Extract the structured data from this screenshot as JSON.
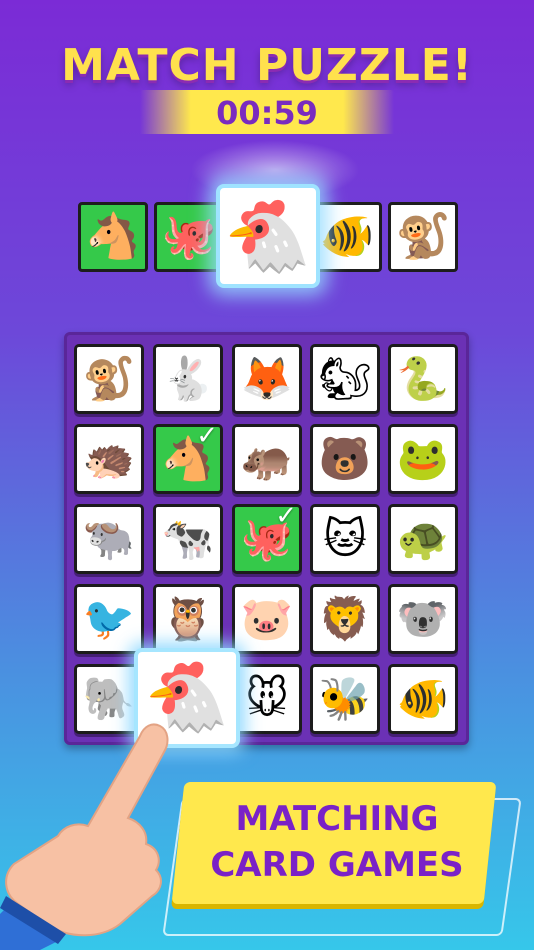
{
  "header": {
    "title": "MATCH PUZZLE!",
    "timer": "00:59"
  },
  "tray": {
    "cards": [
      {
        "animal": "horse",
        "glyph": "🐴",
        "matched": true
      },
      {
        "animal": "octopus",
        "glyph": "🐙",
        "matched": true
      },
      {
        "animal": "fish",
        "glyph": "🐠",
        "matched": false
      },
      {
        "animal": "monkey",
        "glyph": "🐒",
        "matched": false
      }
    ],
    "selected": {
      "animal": "chicken",
      "glyph": "🐔"
    }
  },
  "board": {
    "rows": [
      [
        {
          "animal": "monkey",
          "glyph": "🐒"
        },
        {
          "animal": "rabbit",
          "glyph": "🐇"
        },
        {
          "animal": "fox",
          "glyph": "🦊"
        },
        {
          "animal": "squirrel",
          "glyph": "🐿"
        },
        {
          "animal": "snake",
          "glyph": "🐍"
        }
      ],
      [
        {
          "animal": "hedgehog",
          "glyph": "🦔"
        },
        {
          "animal": "horse",
          "glyph": "🐴",
          "matched": true,
          "check": "✓"
        },
        {
          "animal": "hippo",
          "glyph": "🦛"
        },
        {
          "animal": "bear",
          "glyph": "🐻"
        },
        {
          "animal": "frog",
          "glyph": "🐸"
        }
      ],
      [
        {
          "animal": "yak",
          "glyph": "🐃"
        },
        {
          "animal": "cow",
          "glyph": "🐄"
        },
        {
          "animal": "octopus",
          "glyph": "🐙",
          "matched": true,
          "check": "✓"
        },
        {
          "animal": "cat",
          "glyph": "🐱"
        },
        {
          "animal": "turtle",
          "glyph": "🐢"
        }
      ],
      [
        {
          "animal": "sparrow",
          "glyph": "🐦"
        },
        {
          "animal": "owl",
          "glyph": "🦉"
        },
        {
          "animal": "pig",
          "glyph": "🐷"
        },
        {
          "animal": "lion",
          "glyph": "🦁"
        },
        {
          "animal": "koala",
          "glyph": "🐨"
        }
      ],
      [
        {
          "animal": "elephant",
          "glyph": "🐘"
        },
        {
          "animal": "chicken",
          "glyph": "🐔"
        },
        {
          "animal": "mouse",
          "glyph": "🐭"
        },
        {
          "animal": "wasp",
          "glyph": "🐝"
        },
        {
          "animal": "fish",
          "glyph": "🐠"
        }
      ]
    ],
    "dragging": {
      "animal": "chicken",
      "glyph": "🐔"
    }
  },
  "banner": {
    "line1": "MATCHING",
    "line2": "CARD GAMES"
  },
  "colors": {
    "title": "#ffe14d",
    "timer": "#7a2bbf",
    "board": "#6b31b5",
    "matched": "#35c94a",
    "banner": "#ffe84d",
    "banner_text": "#7a22c7"
  }
}
